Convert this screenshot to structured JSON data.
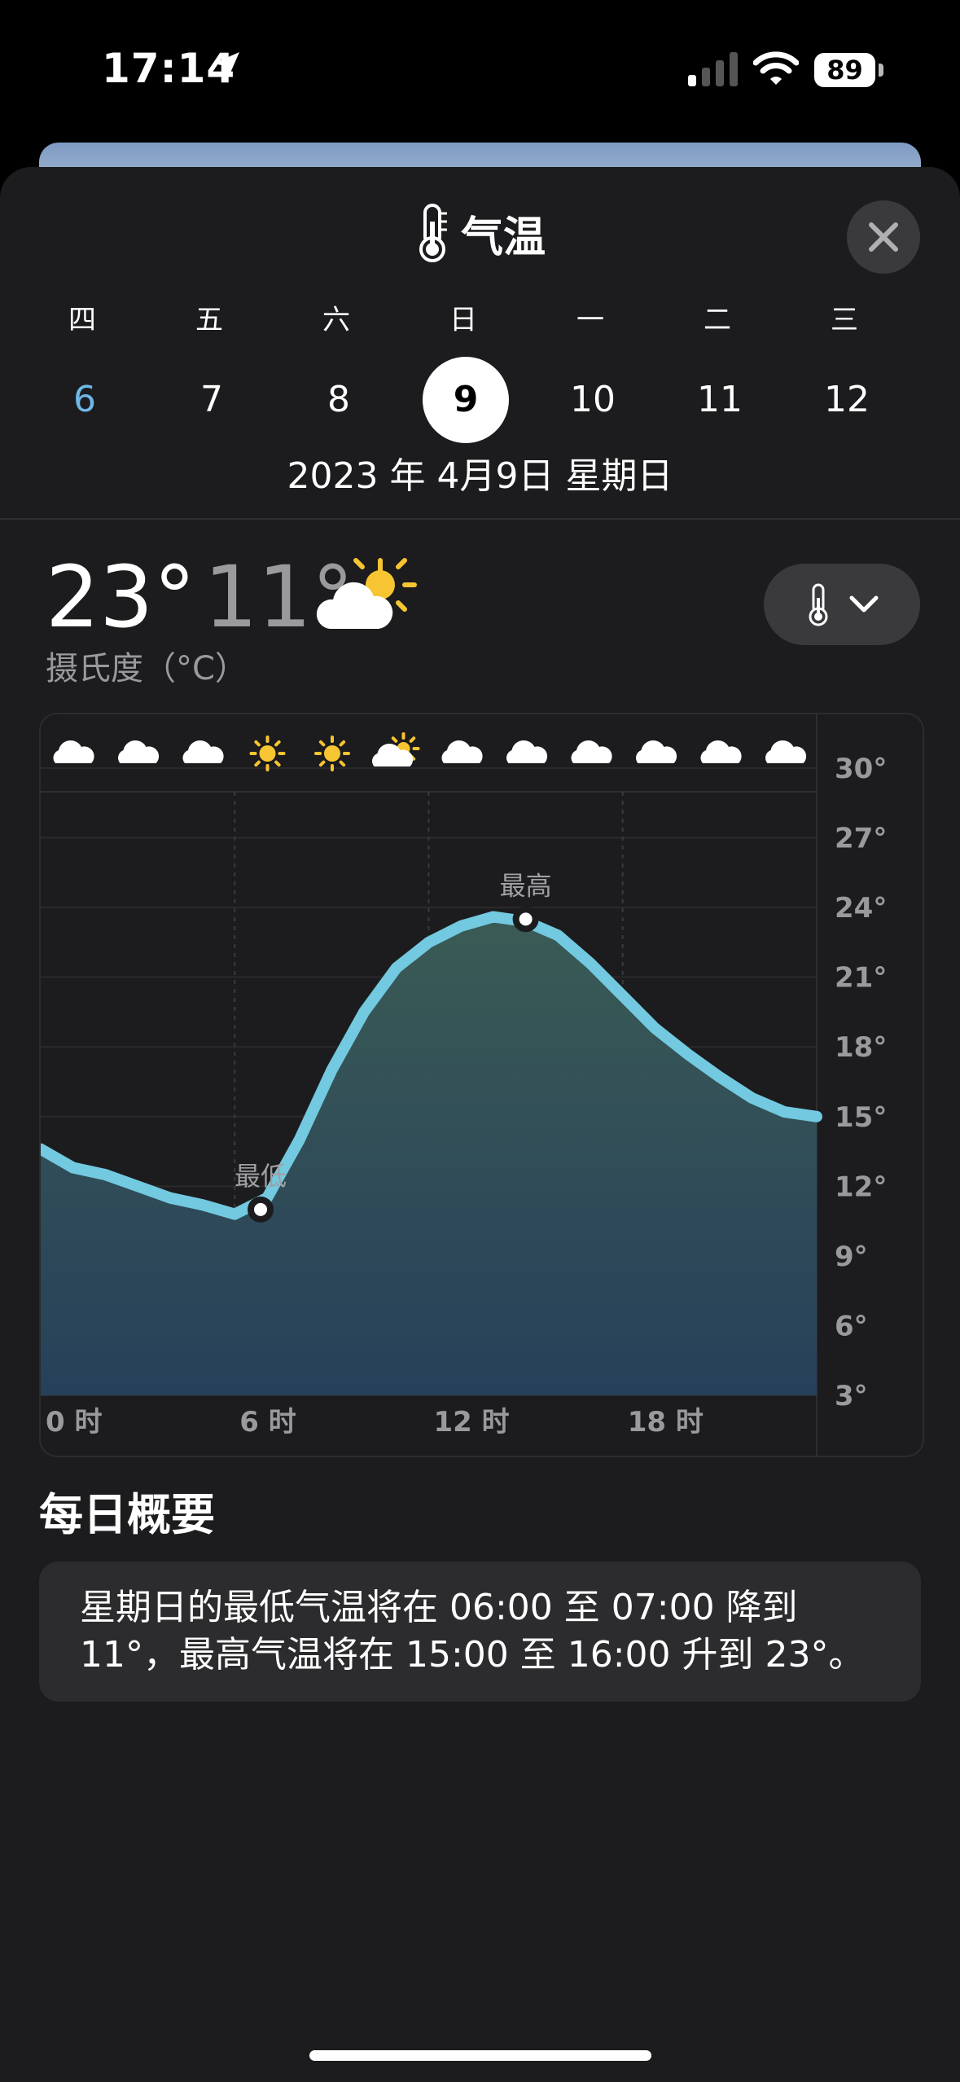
{
  "status_bar": {
    "time": "17:14",
    "battery": "89"
  },
  "header": {
    "title": "气温",
    "icon": "thermometer-icon",
    "close_icon": "close-icon"
  },
  "week": {
    "weekdays": [
      "四",
      "五",
      "六",
      "日",
      "一",
      "二",
      "三"
    ],
    "dates": [
      "6",
      "7",
      "8",
      "9",
      "10",
      "11",
      "12"
    ],
    "selected_index": 3,
    "past_color": "#6fb7e8"
  },
  "selected_date": "2023 年 4月9日 星期日",
  "summary_temps": {
    "high": "23°",
    "low": "11°",
    "condition_icon": "partly-sunny-icon"
  },
  "unit_label": "摄氏度（°C）",
  "metric_menu": {
    "icon": "thermometer-icon",
    "chevron": "chevron-down-icon"
  },
  "chart_data": {
    "type": "area",
    "x": [
      0,
      1,
      2,
      3,
      4,
      5,
      6,
      7,
      8,
      9,
      10,
      11,
      12,
      13,
      14,
      15,
      16,
      17,
      18,
      19,
      20,
      21,
      22,
      23,
      24
    ],
    "y": [
      13.6,
      12.8,
      12.5,
      12.0,
      11.5,
      11.2,
      10.8,
      11.5,
      14.0,
      17.0,
      19.5,
      21.4,
      22.5,
      23.2,
      23.6,
      23.4,
      22.8,
      21.6,
      20.2,
      18.8,
      17.7,
      16.7,
      15.8,
      15.2,
      15.0
    ],
    "xlabel": "",
    "ylabel": "",
    "xlim": [
      0,
      24
    ],
    "ylim": [
      3,
      30
    ],
    "x_ticks": [
      "0 时",
      "6 时",
      "12 时",
      "18 时"
    ],
    "x_tick_values": [
      0,
      6,
      12,
      18
    ],
    "y_ticks": [
      "30°",
      "27°",
      "24°",
      "21°",
      "18°",
      "15°",
      "12°",
      "9°",
      "6°",
      "3°"
    ],
    "y_tick_values": [
      30,
      27,
      24,
      21,
      18,
      15,
      12,
      9,
      6,
      3
    ],
    "annotations": [
      {
        "label": "最低",
        "x": 6.8,
        "y": 11.0
      },
      {
        "label": "最高",
        "x": 15.0,
        "y": 23.5
      }
    ],
    "hourly_icons": [
      "cloud",
      "cloud",
      "cloud",
      "sun",
      "sun",
      "partly-sunny",
      "cloud",
      "cloud",
      "cloud",
      "cloud",
      "cloud",
      "cloud"
    ],
    "grid": true,
    "colors": {
      "line_low": "#72c9e0",
      "line_high": "#c9df9a",
      "fill_top": "#3a5b55",
      "fill_bottom": "#27405a"
    }
  },
  "daily_summary": {
    "title": "每日概要",
    "text": "星期日的最低气温将在 06:00 至 07:00 降到 11°，最高气温将在 15:00 至 16:00 升到 23°。"
  }
}
